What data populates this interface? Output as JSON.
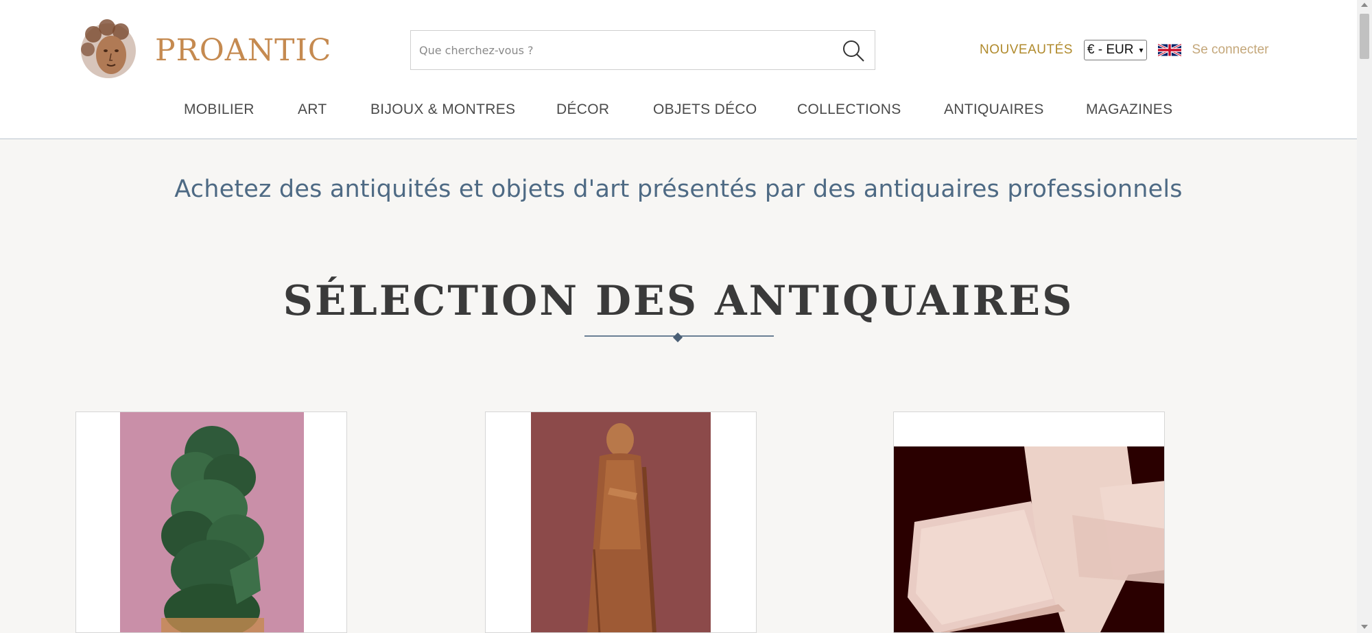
{
  "header": {
    "brand": "PROANTIC",
    "search": {
      "placeholder": "Que cherchez-vous ?"
    },
    "new_link": "NOUVEAUTÉS",
    "currency": "€ - EUR",
    "language_flag": "uk-flag-icon",
    "login": "Se connecter"
  },
  "nav": {
    "items": [
      {
        "label": "MOBILIER"
      },
      {
        "label": "ART"
      },
      {
        "label": "BIJOUX & MONTRES"
      },
      {
        "label": "DÉCOR"
      },
      {
        "label": "OBJETS DÉCO"
      },
      {
        "label": "COLLECTIONS"
      },
      {
        "label": "ANTIQUAIRES"
      },
      {
        "label": "MAGAZINES"
      }
    ]
  },
  "main": {
    "tagline": "Achetez des antiquités et objets d'art présentés par des antiquaires professionnels",
    "section_title": "SÉLECTION DES ANTIQUAIRES",
    "cards": [
      {
        "image": "green-ceramic-tree-sculpture"
      },
      {
        "image": "carved-wooden-saint-statue"
      },
      {
        "image": "lace-linen-napkins"
      }
    ]
  },
  "colors": {
    "brand": "#c58a50",
    "nav_text": "#4a4a4a",
    "accent_gold": "#b08a2c",
    "tagline": "#4e6a84"
  }
}
